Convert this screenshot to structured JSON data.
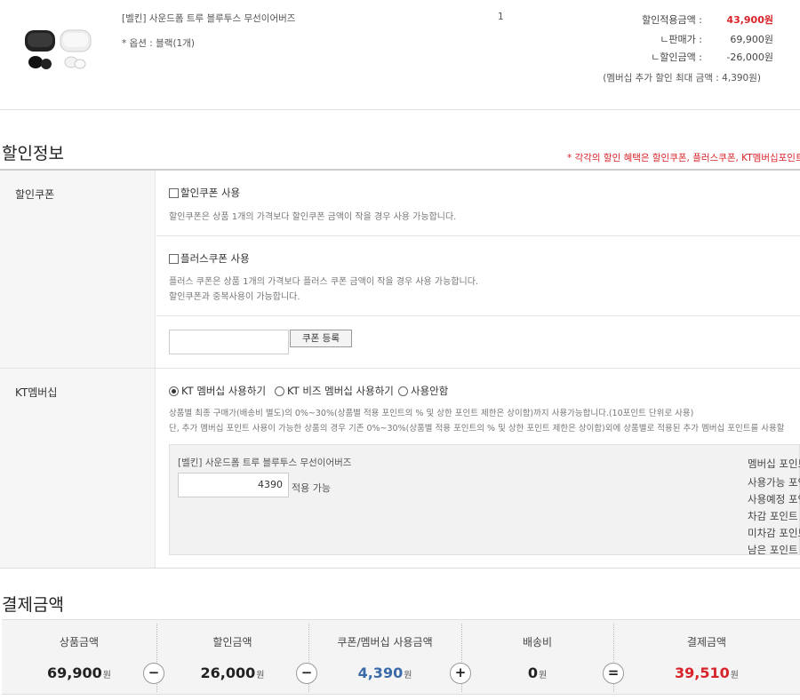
{
  "product": {
    "name": "[벨킨] 사운드폼 트루 블루투스 무선이어버즈",
    "option": "* 옵션 : 블랙(1개)",
    "quantity": "1",
    "discount_applied_label": "할인적용금액 :",
    "discount_applied_value": "43,900원",
    "sale_price_label": "ㄴ판매가 :",
    "sale_price_value": "69,900원",
    "discount_label": "ㄴ할인금액 :",
    "discount_value": "-26,000원",
    "membership_note": "(멤버십 추가 할인 최대 금액 : 4,390원)"
  },
  "discount_info": {
    "title": "할인정보",
    "note": "* 각각의 할인 혜택은 할인쿠폰, 플러스쿠폰, KT멤버십포인트를",
    "coupon": {
      "label": "할인쿠폰",
      "use_coupon": "할인쿠폰 사용",
      "use_coupon_desc": "할인쿠폰은 상품 1개의 가격보다 할인쿠폰 금액이 작을 경우 사용 가능합니다.",
      "plus_coupon": "플러스쿠폰 사용",
      "plus_desc_1": "플러스 쿠폰은 상품 1개의 가격보다 플러스 쿠폰 금액이 작을 경우 사용 가능합니다.",
      "plus_desc_2": "할인쿠폰과 중복사용이 가능합니다.",
      "register_button": "쿠폰 등록",
      "register_input_value": ""
    },
    "kt": {
      "label": "KT멤버십",
      "options": [
        "KT 멤버십 사용하기",
        "KT 비즈 멤버십 사용하기",
        "사용안함"
      ],
      "selected": "KT 멤버십 사용하기",
      "desc_1": "상품별 최종 구매가(배송비 별도)의 0%~30%(상품별 적용 포인트의 % 및 상한 포인트 제한은 상이함)까지 사용가능합니다.(10포인트 단위로 사용)",
      "desc_2": "단, 추가 멤버십 포인트 사용이 가능한 상품의 경우 기존 0%~30%(상품별 적용 포인트의 % 및 상한 포인트 제한은 상이함)외에 상품별로 적용된 추가 멤버십 포인트를 사용할",
      "product_name": "[벨킨] 사운드폼 트루 블루투스 무선이어버즈",
      "point_input": "4390",
      "point_available": "적용 가능",
      "membership_points": [
        "멤버십 포인트",
        "사용가능 포인트",
        "사용예정 포인트",
        "차감 포인트",
        "미차감 포인트",
        "남은 포인트"
      ]
    }
  },
  "payment": {
    "title": "결제금액",
    "columns": [
      {
        "label": "상품금액",
        "value": "69,900",
        "unit": "원"
      },
      {
        "label": "할인금액",
        "value": "26,000",
        "unit": "원"
      },
      {
        "label": "쿠폰/멤버십 사용금액",
        "value": "4,390",
        "unit": "원"
      },
      {
        "label": "배송비",
        "value": "0",
        "unit": "원"
      },
      {
        "label": "결제금액",
        "value": "39,510",
        "unit": "원"
      }
    ],
    "operators": [
      "−",
      "−",
      "+",
      "="
    ]
  },
  "colors": {
    "accent_red": "#d8232a",
    "accent_blue": "#3b6aa8"
  }
}
